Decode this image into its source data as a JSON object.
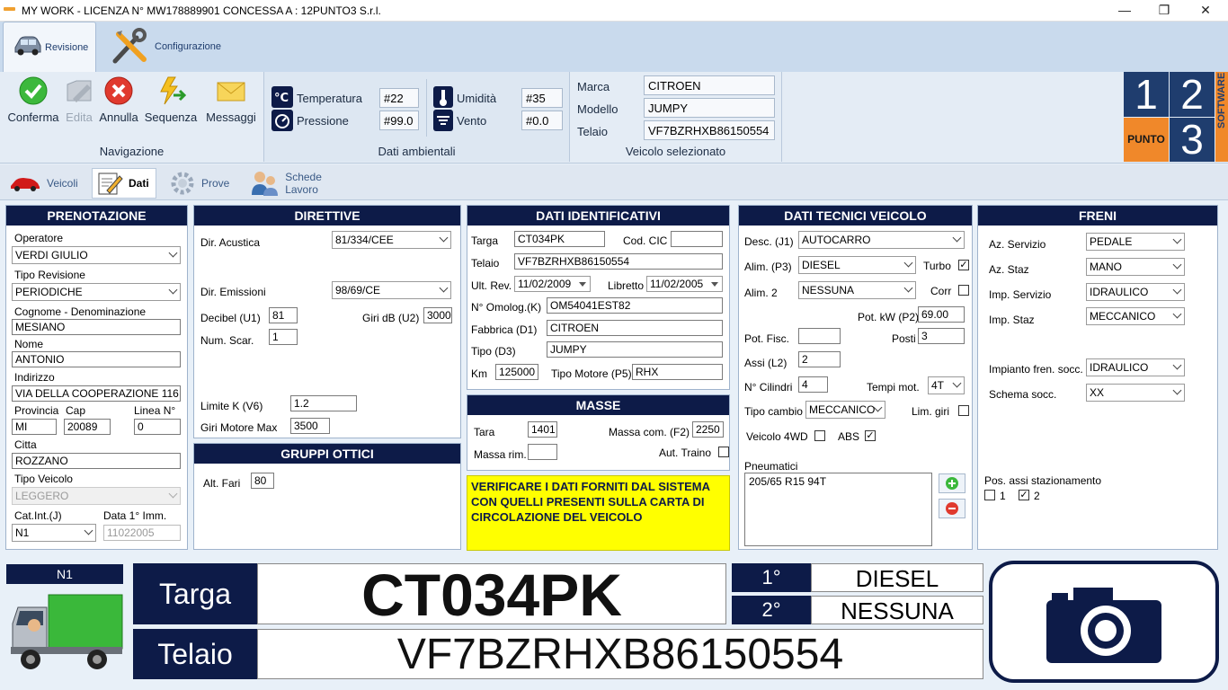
{
  "window": {
    "title": "MY WORK - LICENZA N° MW178889901 CONCESSA A : 12PUNTO3 S.r.l.",
    "min": "—",
    "max": "❐",
    "close": "✕"
  },
  "ribbon": {
    "tabs": [
      {
        "label": "Revisione"
      },
      {
        "label": "Configurazione"
      }
    ],
    "nav": {
      "label": "Navigazione",
      "buttons": [
        {
          "label": "Conferma"
        },
        {
          "label": "Edita"
        },
        {
          "label": "Annulla"
        },
        {
          "label": "Sequenza"
        },
        {
          "label": "Messaggi"
        }
      ]
    },
    "env": {
      "label": "Dati ambientali",
      "temp_label": "Temperatura",
      "temp": "#22",
      "press_label": "Pressione",
      "press": "#99.0",
      "hum_label": "Umidità",
      "hum": "#35",
      "wind_label": "Vento",
      "wind": "#0.0"
    },
    "vehicle": {
      "label": "Veicolo selezionato",
      "marca_label": "Marca",
      "marca": "CITROEN",
      "modello_label": "Modello",
      "modello": "JUMPY",
      "telaio_label": "Telaio",
      "telaio": "VF7BZRHXB86150554"
    },
    "logo": {
      "d1": "1",
      "d2": "2",
      "d3": "3",
      "punto": "PUNTO",
      "software": "SOFTWARE"
    }
  },
  "subtabs": [
    {
      "label": "Veicoli"
    },
    {
      "label": "Dati"
    },
    {
      "label": "Prove"
    },
    {
      "label": "Schede Lavoro"
    }
  ],
  "prenotazione": {
    "title": "PRENOTAZIONE",
    "operatore_label": "Operatore",
    "operatore": "VERDI GIULIO",
    "tipo_rev_label": "Tipo Revisione",
    "tipo_rev": "PERIODICHE",
    "cognome_label": "Cognome  - Denominazione",
    "cognome": "MESIANO",
    "nome_label": "Nome",
    "nome": "ANTONIO",
    "indirizzo_label": "Indirizzo",
    "indirizzo": "VIA DELLA COOPERAZIONE 116",
    "prov_label": "Provincia",
    "prov": "MI",
    "cap_label": "Cap",
    "cap": "20089",
    "linea_label": "Linea N°",
    "linea": "0",
    "citta_label": "Citta",
    "citta": "ROZZANO",
    "tipo_veicolo_label": "Tipo Veicolo",
    "tipo_veicolo": "LEGGERO",
    "catint_label": "Cat.Int.(J)",
    "catint": "N1",
    "data_imm_label": "Data 1° Imm.",
    "data_imm": "11022005"
  },
  "direttive": {
    "title": "DIRETTIVE",
    "acustica_label": "Dir. Acustica",
    "acustica": "81/334/CEE",
    "emissioni_label": "Dir. Emissioni",
    "emissioni": "98/69/CE",
    "decibel_label": "Decibel (U1)",
    "decibel": "81",
    "giri_db_label": "Giri dB (U2)",
    "giri_db": "3000",
    "num_scar_label": "Num. Scar.",
    "num_scar": "1",
    "limite_label": "Limite K (V6)",
    "limite": "1.2",
    "giri_max_label": "Giri Motore Max",
    "giri_max": "3500"
  },
  "ottici": {
    "title": "GRUPPI OTTICI",
    "alt_label": "Alt. Fari",
    "alt": "80"
  },
  "identificativi": {
    "title": "DATI IDENTIFICATIVI",
    "targa_label": "Targa",
    "targa": "CT034PK",
    "cic_label": "Cod. CIC",
    "cic": "",
    "telaio_label": "Telaio",
    "telaio": "VF7BZRHXB86150554",
    "ultrev_label": "Ult. Rev.",
    "ultrev": "11/02/2009",
    "libretto_label": "Libretto",
    "libretto": "11/02/2005",
    "omolog_label": "N° Omolog.(K)",
    "omolog": "OM54041EST82",
    "fabbrica_label": "Fabbrica (D1)",
    "fabbrica": "CITROEN",
    "tipo_label": "Tipo (D3)",
    "tipo": "JUMPY",
    "km_label": "Km",
    "km": "125000",
    "motore_label": "Tipo Motore (P5)",
    "motore": "RHX"
  },
  "masse": {
    "title": "MASSE",
    "tara_label": "Tara",
    "tara": "1401",
    "massacom_label": "Massa com. (F2)",
    "massacom": "2250",
    "massarim_label": "Massa rim.",
    "massarim": "",
    "traino_label": "Aut. Traino"
  },
  "warning": "VERIFICARE I DATI FORNITI DAL SISTEMA CON QUELLI PRESENTI SULLA CARTA DI CIRCOLAZIONE DEL VEICOLO",
  "tecnici": {
    "title": "DATI TECNICI VEICOLO",
    "desc_label": "Desc. (J1)",
    "desc": "AUTOCARRO",
    "alim_label": "Alim. (P3)",
    "alim": "DIESEL",
    "turbo_label": "Turbo",
    "alim2_label": "Alim. 2",
    "alim2": "NESSUNA",
    "corr_label": "Corr",
    "potkw_label": "Pot. kW (P2)",
    "potkw": "69.00",
    "potfisc_label": "Pot. Fisc.",
    "potfisc": "",
    "posti_label": "Posti",
    "posti": "3",
    "assi_label": "Assi (L2)",
    "assi": "2",
    "cilindri_label": "N° Cilindri",
    "cilindri": "4",
    "tempi_label": "Tempi mot.",
    "tempi": "4T",
    "cambio_label": "Tipo cambio",
    "cambio": "MECCANICO",
    "limgiri_label": "Lim. giri",
    "wd_label": "Veicolo 4WD",
    "abs_label": "ABS",
    "pneu_label": "Pneumatici",
    "pneu": "205/65 R15 94T"
  },
  "freni": {
    "title": "FRENI",
    "serv_label": "Az. Servizio",
    "serv": "PEDALE",
    "staz_label": "Az. Staz",
    "staz": "MANO",
    "impserv_label": "Imp. Servizio",
    "impserv": "IDRAULICO",
    "impstaz_label": "Imp. Staz",
    "impstaz": "MECCANICO",
    "soc_label": "Impianto fren. socc.",
    "soc": "IDRAULICO",
    "schema_label": "Schema socc.",
    "schema": "XX",
    "pos_label": "Pos. assi stazionamento",
    "pos1": "1",
    "pos2": "2"
  },
  "bottom": {
    "cat": "N1",
    "targa_label": "Targa",
    "targa": "CT034PK",
    "telaio_label": "Telaio",
    "telaio": "VF7BZRHXB86150554",
    "f1": "1°",
    "f1v": "DIESEL",
    "f2": "2°",
    "f2v": "NESSUNA"
  },
  "colors": {
    "navy": "#0d1b48",
    "warning": "#ffff00",
    "orange": "#f0882a"
  }
}
